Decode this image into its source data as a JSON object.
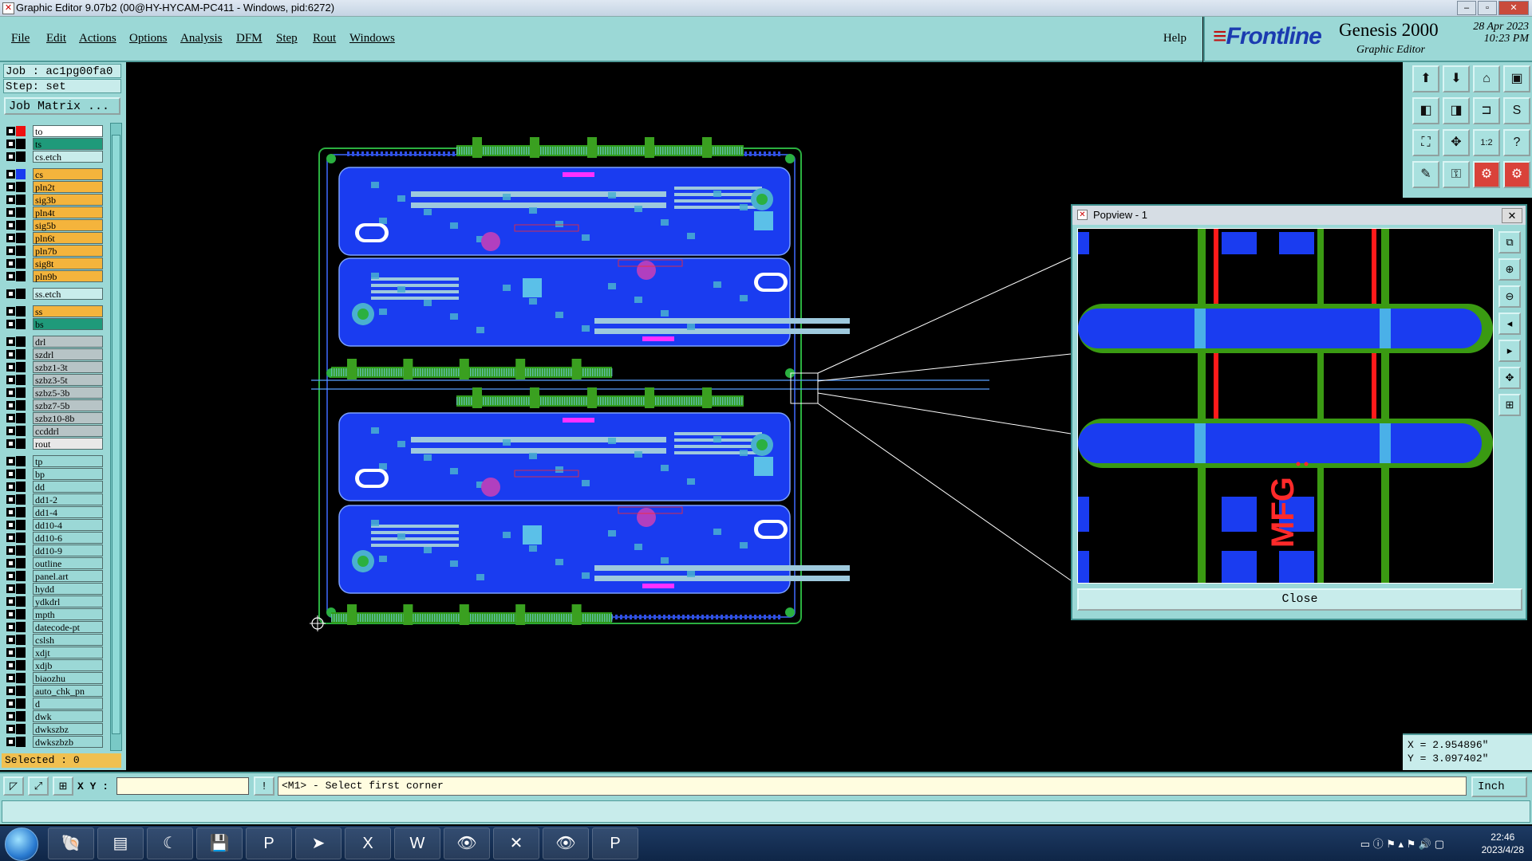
{
  "window": {
    "title": "Graphic Editor 9.07b2 (00@HY-HYCAM-PC411 - Windows, pid:6272)"
  },
  "menu": {
    "items": [
      "File",
      "Edit",
      "Actions",
      "Options",
      "Analysis",
      "DFM",
      "Step",
      "Rout",
      "Windows"
    ],
    "help": "Help"
  },
  "brand": {
    "logo": "Frontline",
    "product": "Genesis 2000",
    "subtitle": "Graphic Editor",
    "date": "28 Apr 2023",
    "time": "10:23 PM"
  },
  "job": {
    "job_label": "Job : ac1pg00fa0",
    "step_label": "Step: set",
    "matrix_button": "Job Matrix ..."
  },
  "layers": [
    {
      "name": "to",
      "bg": "#ffffff",
      "sw": "#e11"
    },
    {
      "name": "ts",
      "bg": "#1f9a7a",
      "sw": "#000"
    },
    {
      "name": "cs.etch",
      "bg": "#c8eceb",
      "sw": "#000"
    },
    {
      "name": "cs",
      "bg": "#f4b43c",
      "sw": "#1a3cf0"
    },
    {
      "name": "pln2t",
      "bg": "#f4b43c",
      "sw": "#000"
    },
    {
      "name": "sig3b",
      "bg": "#f4b43c",
      "sw": "#000"
    },
    {
      "name": "pln4t",
      "bg": "#f4b43c",
      "sw": "#000"
    },
    {
      "name": "sig5b",
      "bg": "#f4b43c",
      "sw": "#000"
    },
    {
      "name": "pln6t",
      "bg": "#f4b43c",
      "sw": "#000"
    },
    {
      "name": "pln7b",
      "bg": "#f4b43c",
      "sw": "#000"
    },
    {
      "name": "sig8t",
      "bg": "#f4b43c",
      "sw": "#000"
    },
    {
      "name": "pln9b",
      "bg": "#f4b43c",
      "sw": "#000"
    },
    {
      "name": "ss.etch",
      "bg": "#c8eceb",
      "sw": "#000"
    },
    {
      "name": "ss",
      "bg": "#f4b43c",
      "sw": "#000"
    },
    {
      "name": "bs",
      "bg": "#1f9a7a",
      "sw": "#000"
    },
    {
      "name": "drl",
      "bg": "#b7c4c6",
      "sw": "#000"
    },
    {
      "name": "szdrl",
      "bg": "#b7c4c6",
      "sw": "#000"
    },
    {
      "name": "szbz1-3t",
      "bg": "#b7c4c6",
      "sw": "#000"
    },
    {
      "name": "szbz3-5t",
      "bg": "#b7c4c6",
      "sw": "#000"
    },
    {
      "name": "szbz5-3b",
      "bg": "#b7c4c6",
      "sw": "#000"
    },
    {
      "name": "szbz7-5b",
      "bg": "#b7c4c6",
      "sw": "#000"
    },
    {
      "name": "szbz10-8b",
      "bg": "#b7c4c6",
      "sw": "#000"
    },
    {
      "name": "ccddrl",
      "bg": "#b7c4c6",
      "sw": "#000"
    },
    {
      "name": "rout",
      "bg": "#e8e8e8",
      "sw": "#000"
    },
    {
      "name": "tp",
      "bg": "#9bd8d6",
      "sw": "#000"
    },
    {
      "name": "bp",
      "bg": "#9bd8d6",
      "sw": "#000"
    },
    {
      "name": "dd",
      "bg": "#9bd8d6",
      "sw": "#000"
    },
    {
      "name": "dd1-2",
      "bg": "#9bd8d6",
      "sw": "#000"
    },
    {
      "name": "dd1-4",
      "bg": "#9bd8d6",
      "sw": "#000"
    },
    {
      "name": "dd10-4",
      "bg": "#9bd8d6",
      "sw": "#000"
    },
    {
      "name": "dd10-6",
      "bg": "#9bd8d6",
      "sw": "#000"
    },
    {
      "name": "dd10-9",
      "bg": "#9bd8d6",
      "sw": "#000"
    },
    {
      "name": "outline",
      "bg": "#9bd8d6",
      "sw": "#000"
    },
    {
      "name": "panel.art",
      "bg": "#9bd8d6",
      "sw": "#000"
    },
    {
      "name": "hydd",
      "bg": "#9bd8d6",
      "sw": "#000"
    },
    {
      "name": "ydkdrl",
      "bg": "#9bd8d6",
      "sw": "#000"
    },
    {
      "name": "mpth",
      "bg": "#9bd8d6",
      "sw": "#000"
    },
    {
      "name": "datecode-pt",
      "bg": "#9bd8d6",
      "sw": "#000"
    },
    {
      "name": "cslsh",
      "bg": "#9bd8d6",
      "sw": "#000"
    },
    {
      "name": "xdjt",
      "bg": "#9bd8d6",
      "sw": "#000"
    },
    {
      "name": "xdjb",
      "bg": "#9bd8d6",
      "sw": "#000"
    },
    {
      "name": "biaozhu",
      "bg": "#9bd8d6",
      "sw": "#000"
    },
    {
      "name": "auto_chk_pn",
      "bg": "#9bd8d6",
      "sw": "#000"
    },
    {
      "name": "d",
      "bg": "#9bd8d6",
      "sw": "#000"
    },
    {
      "name": "dwk",
      "bg": "#9bd8d6",
      "sw": "#000"
    },
    {
      "name": "dwkszbz",
      "bg": "#9bd8d6",
      "sw": "#000"
    },
    {
      "name": "dwkszbzb",
      "bg": "#9bd8d6",
      "sw": "#000"
    }
  ],
  "selected": "Selected : 0",
  "popview": {
    "title": "Popview - 1",
    "close_label": "Close",
    "mark_text": "MFG"
  },
  "coords": {
    "x": "X = 2.954896\"",
    "y": "Y = 3.097402\""
  },
  "command": {
    "xy_label": "X Y :",
    "xy_value": "",
    "prompt": "<M1> - Select first corner",
    "units": "Inch"
  },
  "taskbar": {
    "time": "22:46",
    "date": "2023/4/28"
  },
  "colors": {
    "panel": "#9bd8d6",
    "board_copper": "#1a3cf0",
    "board_pads": "#4ab0d0",
    "connector": "#2e9a1a",
    "silkscreen": "#ff2a2a",
    "magenta": "#ff30ff"
  }
}
